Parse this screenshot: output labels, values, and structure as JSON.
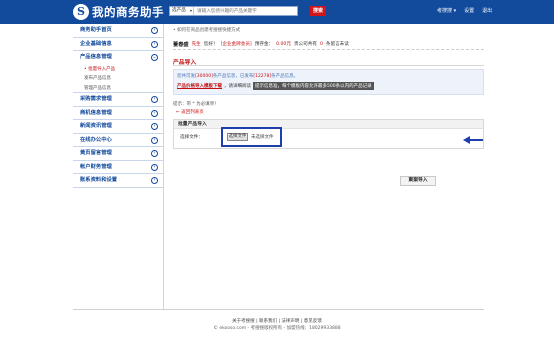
{
  "header": {
    "logo_text": "我的商务助手",
    "logo_mark": "S",
    "search_select": "选产品",
    "search_placeholder": "请输入您感兴趣的产品关键字",
    "search_button": "搜索",
    "links": [
      "考搜搜 ▾",
      "设置",
      "退出"
    ]
  },
  "sidebar": {
    "items": [
      {
        "label": "商务助手首页"
      },
      {
        "label": "企业基础信息"
      },
      {
        "label": "产品信息管理"
      },
      {
        "label": "采购需求管理"
      },
      {
        "label": "商机信息管理"
      },
      {
        "label": "新闻资讯管理"
      },
      {
        "label": "在线办公中心"
      },
      {
        "label": "黄页留言管理"
      },
      {
        "label": "帐户财务管理"
      },
      {
        "label": "账系资料和设置"
      }
    ],
    "sub_items": [
      "• 批量导入产品",
      "发布产品信息",
      "管理产品信息"
    ]
  },
  "main": {
    "tip": "• 如何在商品创建考搜搜快捷方式",
    "user": {
      "name": "董春盛",
      "title": "先生",
      "greeting": "您好！",
      "level": "[企业金牌会员]",
      "balance_label": "预存金：",
      "balance": "0.00元",
      "products_label": "贵公司共有",
      "products_count": "0",
      "products_tail": "条留言未读"
    },
    "section_title": "产品导入",
    "info1_a": "您共可发",
    "info1_total": "[30000]",
    "info1_b": "条产品信息，已发布",
    "info1_used": "[12278]",
    "info1_c": "条产品信息。",
    "info2_download": "产品价格导入模板下载",
    "info2_text": "，请详细阅读",
    "info2_dark": "提示信息准，每个模板内容允许最多500条以内的产品记录",
    "hint": "提示：带 * 为必填项！",
    "back_link": "← 返回列表页",
    "form_head": "批量产品导入",
    "file_label": "选择文件：",
    "file_button": "选择文件",
    "file_none": "未选择文件",
    "submit": "東案导入"
  },
  "footer": {
    "links": "关于考搜搜 | 联系我们 | 法律声明 | 意见反馈",
    "copyright": "© ekooso.com - 考搜搜版权所有 - 加盟热线：18029933888",
    "line3": ""
  },
  "colors": {
    "brand": "#124a9c",
    "accent_red": "#c41010",
    "highlight": "#1f3fae"
  }
}
